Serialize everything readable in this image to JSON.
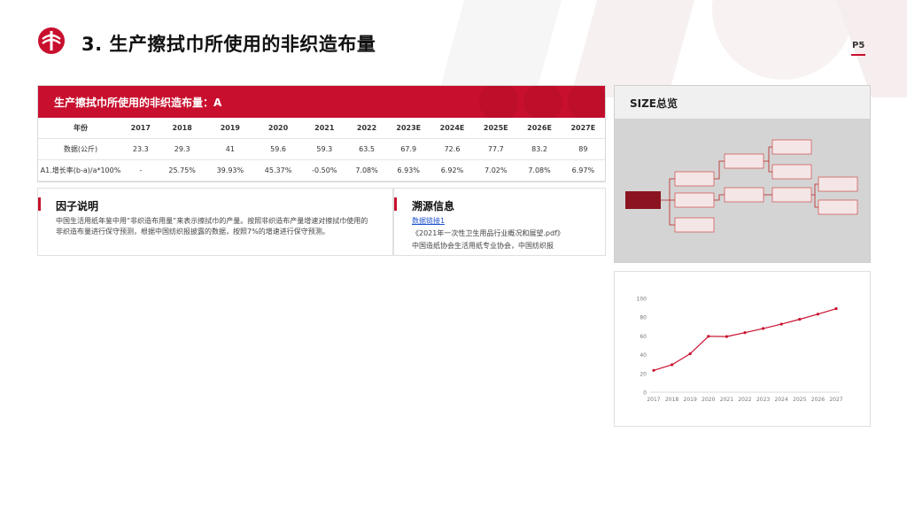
{
  "header": {
    "title": "3. 生产擦拭巾所使用的非织造布量",
    "page_number": "P5"
  },
  "table": {
    "title": "生产擦拭巾所使用的非织造布量：A",
    "columns": [
      "年份",
      "2017",
      "2018",
      "2019",
      "2020",
      "2021",
      "2022",
      "2023E",
      "2024E",
      "2025E",
      "2026E",
      "2027E"
    ],
    "rows": [
      [
        "数据(公斤)",
        "23.3",
        "29.3",
        "41",
        "59.6",
        "59.3",
        "63.5",
        "67.9",
        "72.6",
        "77.7",
        "83.2",
        "89"
      ],
      [
        "A1.增长率(b-a)/a*100%",
        "-",
        "25.75%",
        "39.93%",
        "45.37%",
        "-0.50%",
        "7.08%",
        "6.93%",
        "6.92%",
        "7.02%",
        "7.08%",
        "6.97%"
      ]
    ]
  },
  "factor": {
    "title": "因子说明",
    "text": "中国生活用纸年鉴中用“非织造布用量”来表示擦拭巾的产量。按照非织造布产量增速对擦拭巾使用的非织造布量进行保守预测，根据中国纺织报披露的数据，按照7%的增速进行保守预测。"
  },
  "source": {
    "title": "溯源信息",
    "link_label": "数据链接1",
    "line1": "《2021年一次性卫生用品行业概况和展望.pdf》",
    "line2": "中国造纸协会生活用纸专业协会，中国纺织报"
  },
  "size_panel": {
    "title": "SIZE总览"
  },
  "chart_data": {
    "type": "line",
    "categories": [
      "2017",
      "2018",
      "2019",
      "2020",
      "2021",
      "2022",
      "2023",
      "2024",
      "2025",
      "2026",
      "2027"
    ],
    "values": [
      23.3,
      29.3,
      41,
      59.6,
      59.3,
      63.5,
      67.9,
      72.6,
      77.7,
      83.2,
      89
    ],
    "y_ticks": [
      "0",
      "20",
      "40",
      "60",
      "80",
      "100"
    ],
    "ylim": [
      0,
      100
    ],
    "grid": false,
    "line_color": "#c8102e"
  },
  "colors": {
    "accent": "#c8102e"
  }
}
